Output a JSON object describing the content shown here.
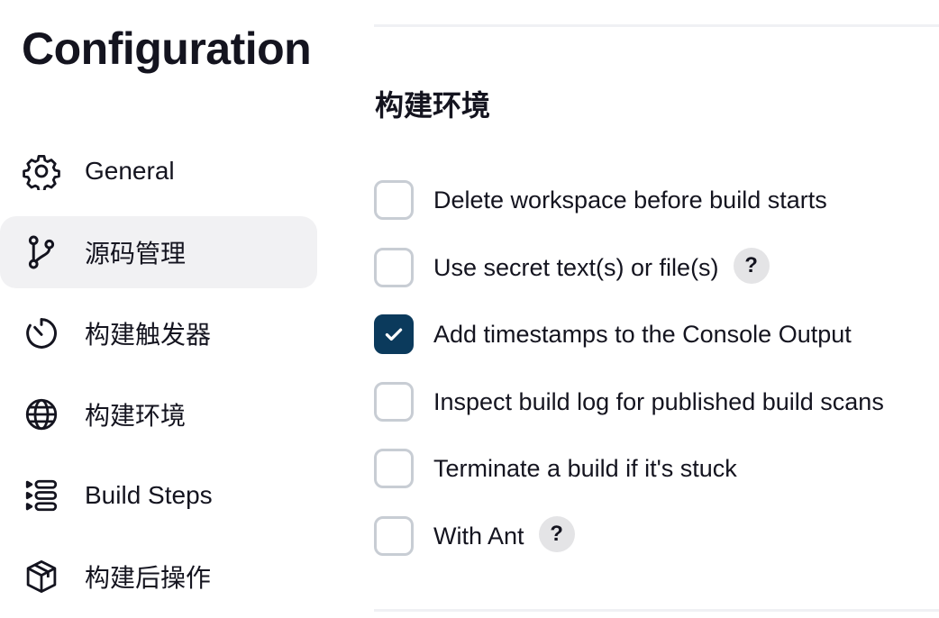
{
  "sidebar": {
    "title": "Configuration",
    "items": [
      {
        "label": "General",
        "icon": "gear-icon",
        "active": false
      },
      {
        "label": "源码管理",
        "icon": "git-branch-icon",
        "active": true
      },
      {
        "label": "构建触发器",
        "icon": "timer-icon",
        "active": false
      },
      {
        "label": "构建环境",
        "icon": "globe-icon",
        "active": false
      },
      {
        "label": "Build Steps",
        "icon": "list-steps-icon",
        "active": false
      },
      {
        "label": "构建后操作",
        "icon": "package-icon",
        "active": false
      }
    ]
  },
  "main": {
    "section_title": "构建环境",
    "options": [
      {
        "label": "Delete workspace before build starts",
        "checked": false,
        "has_help": false
      },
      {
        "label": "Use secret text(s) or file(s)",
        "checked": false,
        "has_help": true
      },
      {
        "label": "Add timestamps to the Console Output",
        "checked": true,
        "has_help": false
      },
      {
        "label": "Inspect build log for published build scans",
        "checked": false,
        "has_help": false
      },
      {
        "label": "Terminate a build if it's stuck",
        "checked": false,
        "has_help": false
      },
      {
        "label": "With Ant",
        "checked": false,
        "has_help": true
      }
    ],
    "help_label": "?"
  },
  "colors": {
    "accent": "#0b3a5c",
    "active_nav_bg": "#f1f1f3",
    "checkbox_border": "#c8cdd4",
    "help_bg": "#e4e4e6",
    "text": "#14141f"
  }
}
